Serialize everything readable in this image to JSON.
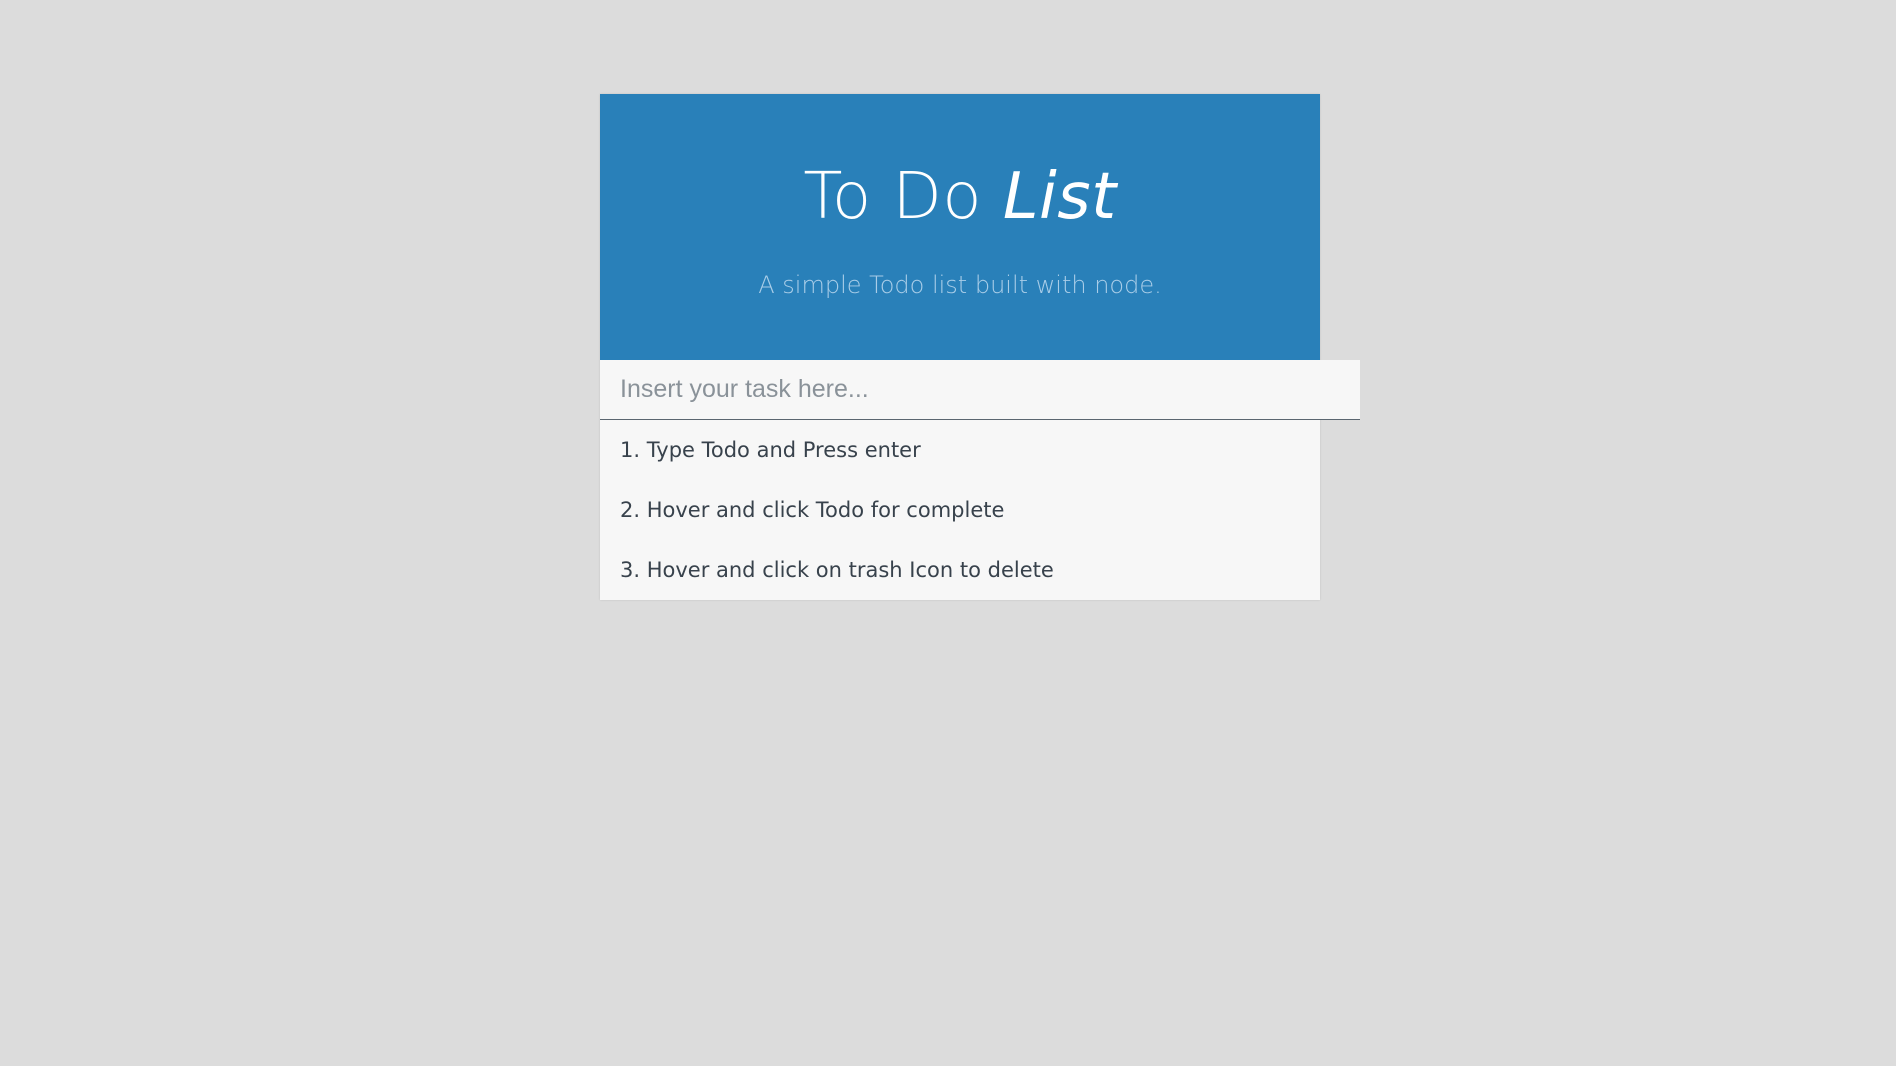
{
  "header": {
    "title_main": "To Do ",
    "title_emph": "List",
    "subtitle": "A simple Todo list built with node.",
    "background_color": "#2980b9"
  },
  "input": {
    "placeholder": "Insert your task here...",
    "value": ""
  },
  "todos": [
    {
      "label": "1. Type Todo and Press enter"
    },
    {
      "label": "2. Hover and click Todo for complete"
    },
    {
      "label": "3. Hover and click on trash Icon to delete"
    }
  ],
  "colors": {
    "page_background": "#dcdcdc",
    "list_background": "#f7f7f7",
    "text": "#38424c"
  }
}
